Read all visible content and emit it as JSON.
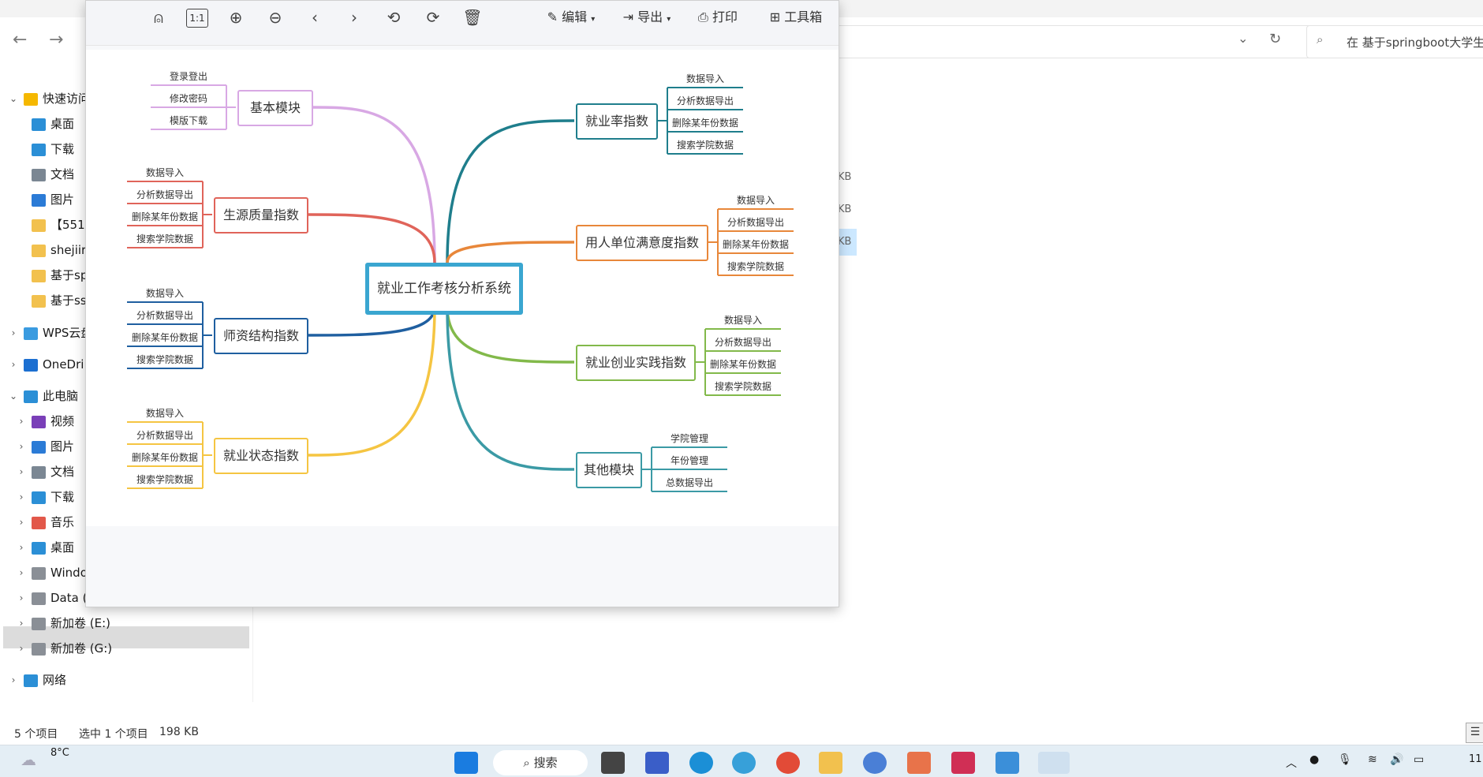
{
  "explorer": {
    "search_placeholder": "在 基于springboot大学生",
    "sidebar": [
      {
        "label": "快速访问",
        "icon": "star-icon"
      },
      {
        "label": "桌面",
        "icon": "desktop-icon"
      },
      {
        "label": "下载",
        "icon": "download-icon"
      },
      {
        "label": "文档",
        "icon": "document-icon"
      },
      {
        "label": "图片",
        "icon": "pictures-icon"
      },
      {
        "label": "【551",
        "icon": "folder-icon"
      },
      {
        "label": "shejiir",
        "icon": "folder-icon"
      },
      {
        "label": "基于sp",
        "icon": "folder-icon"
      },
      {
        "label": "基于ss",
        "icon": "folder-icon"
      },
      {
        "label": "WPS云盘",
        "icon": "cloud-icon"
      },
      {
        "label": "OneDri",
        "icon": "onedrive-icon"
      },
      {
        "label": "此电脑",
        "icon": "pc-icon"
      },
      {
        "label": "视频",
        "icon": "video-icon"
      },
      {
        "label": "图片",
        "icon": "pictures-icon"
      },
      {
        "label": "文档",
        "icon": "document-icon"
      },
      {
        "label": "下载",
        "icon": "download-icon"
      },
      {
        "label": "音乐",
        "icon": "music-icon"
      },
      {
        "label": "桌面",
        "icon": "desktop-icon"
      },
      {
        "label": "Windo",
        "icon": "drive-icon"
      },
      {
        "label": "Data (",
        "icon": "drive-icon"
      },
      {
        "label": "新加卷 (E:)",
        "icon": "drive-icon"
      },
      {
        "label": "新加卷 (G:)",
        "icon": "drive-icon"
      },
      {
        "label": "网络",
        "icon": "network-icon"
      }
    ],
    "kb_column": [
      "KB",
      "KB",
      "KB"
    ],
    "status": {
      "count": "5 个项目",
      "selected": "选中 1 个项目",
      "size": "198 KB"
    }
  },
  "viewer": {
    "toolbar": {
      "edit": "编辑",
      "export": "导出",
      "print": "打印",
      "toolbox": "工具箱",
      "zoom_label": "1:1"
    },
    "mindmap": {
      "root": "就业工作考核分析系统",
      "branches": [
        {
          "label": "基本模块",
          "color": "#d8a8e4",
          "leaves": [
            "登录登出",
            "修改密码",
            "模版下载"
          ]
        },
        {
          "label": "生源质量指数",
          "color": "#e0645a",
          "leaves": [
            "数据导入",
            "分析数据导出",
            "删除某年份数据",
            "搜索学院数据"
          ]
        },
        {
          "label": "师资结构指数",
          "color": "#1f5fa0",
          "leaves": [
            "数据导入",
            "分析数据导出",
            "删除某年份数据",
            "搜索学院数据"
          ]
        },
        {
          "label": "就业状态指数",
          "color": "#f5c542",
          "leaves": [
            "数据导入",
            "分析数据导出",
            "删除某年份数据",
            "搜索学院数据"
          ]
        },
        {
          "label": "就业率指数",
          "color": "#1f7e8c",
          "leaves": [
            "数据导入",
            "分析数据导出",
            "删除某年份数据",
            "搜索学院数据"
          ]
        },
        {
          "label": "用人单位满意度指数",
          "color": "#e8873a",
          "leaves": [
            "数据导入",
            "分析数据导出",
            "删除某年份数据",
            "搜索学院数据"
          ]
        },
        {
          "label": "就业创业实践指数",
          "color": "#82b94a",
          "leaves": [
            "数据导入",
            "分析数据导出",
            "删除某年份数据",
            "搜索学院数据"
          ]
        },
        {
          "label": "其他模块",
          "color": "#3b9aa5",
          "leaves": [
            "学院管理",
            "年份管理",
            "总数据导出"
          ]
        }
      ]
    }
  },
  "taskbar": {
    "weather": "8°C",
    "search_label": "搜索",
    "clock": "11:"
  }
}
